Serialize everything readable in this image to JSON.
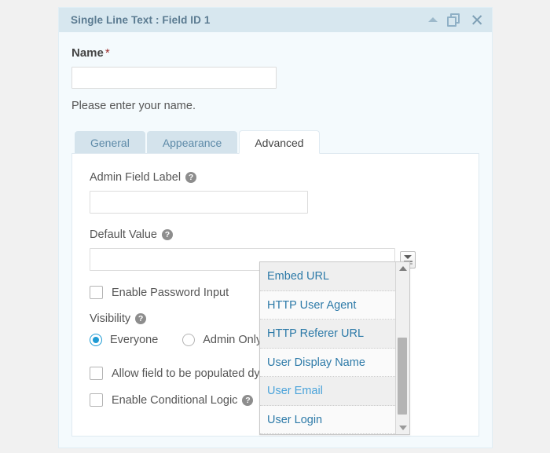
{
  "panel": {
    "title": "Single Line Text : Field ID 1",
    "icons": {
      "collapse": "chevron-up-icon",
      "duplicate": "duplicate-icon",
      "close": "close-icon"
    }
  },
  "field_preview": {
    "label": "Name",
    "required_marker": "*",
    "input_value": "",
    "input_placeholder": "",
    "description": "Please enter your name."
  },
  "tabs": [
    {
      "label": "General",
      "active": false
    },
    {
      "label": "Appearance",
      "active": false
    },
    {
      "label": "Advanced",
      "active": true
    }
  ],
  "advanced": {
    "admin_field_label": {
      "label": "Admin Field Label",
      "help": "?",
      "value": "",
      "placeholder": ""
    },
    "default_value": {
      "label": "Default Value",
      "help": "?",
      "value": "",
      "placeholder": "",
      "mergetag_button": "merge-tag-button"
    },
    "enable_password_input": {
      "label": "Enable Password Input",
      "checked": false
    },
    "visibility": {
      "label": "Visibility",
      "help": "?",
      "options": [
        {
          "label": "Everyone",
          "selected": true
        },
        {
          "label": "Admin Only",
          "selected": false
        }
      ]
    },
    "allow_dynamic_population": {
      "label": "Allow field to be populated dynamically",
      "checked": false
    },
    "enable_conditional_logic": {
      "label": "Enable Conditional Logic",
      "help": "?",
      "checked": false
    }
  },
  "mergetag_dropdown": {
    "items": [
      {
        "label": "Embed URL",
        "hovered": false
      },
      {
        "label": "HTTP User Agent",
        "hovered": false
      },
      {
        "label": "HTTP Referer URL",
        "hovered": false
      },
      {
        "label": "User Display Name",
        "hovered": false
      },
      {
        "label": "User Email",
        "hovered": true
      },
      {
        "label": "User Login",
        "hovered": false
      }
    ],
    "scrollbar": {
      "up_arrow": "scroll-up-arrow",
      "down_arrow": "scroll-down-arrow"
    }
  },
  "colors": {
    "header_bg": "#d7e7ef",
    "panel_bg": "#f4fafd",
    "accent_blue": "#1f9bd4",
    "link_blue": "#2d7aa8",
    "required_red": "#9a2b2b",
    "page_bg": "#f1f1f1"
  }
}
